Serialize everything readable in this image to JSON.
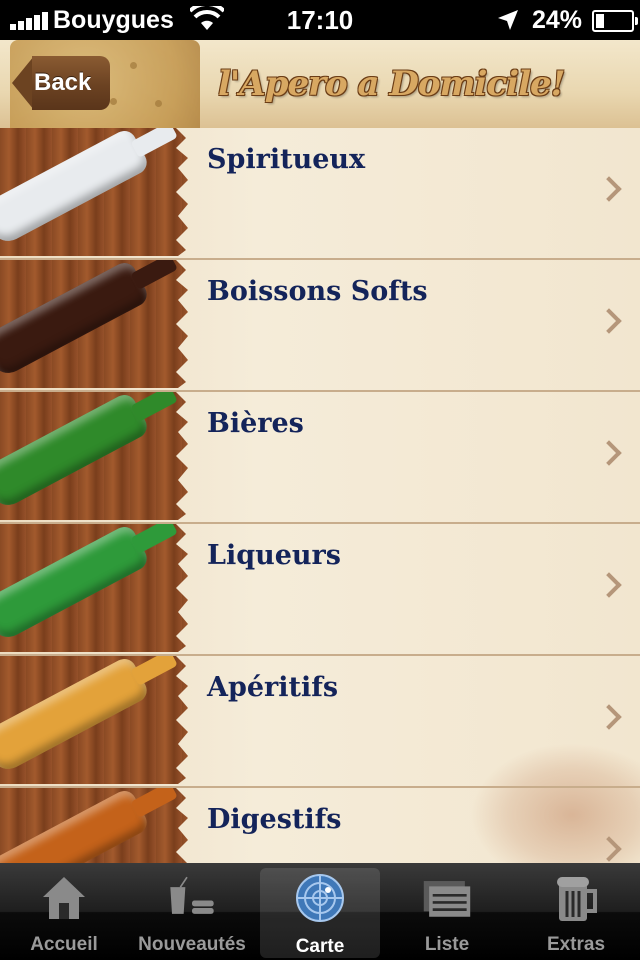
{
  "status_bar": {
    "carrier": "Bouygues",
    "time": "17:10",
    "battery_percent": "24%",
    "battery_level": 0.24
  },
  "header": {
    "back_label": "Back",
    "logo_text": "l'Apero a Domicile!"
  },
  "categories": [
    {
      "label": "Spiritueux",
      "icon": "vodka-bottle-icon",
      "bottle_color": "#e8ebee"
    },
    {
      "label": "Boissons Softs",
      "icon": "cola-bottle-icon",
      "bottle_color": "#3a1a10"
    },
    {
      "label": "Bières",
      "icon": "beer-bottles-icon",
      "bottle_color": "#2f8a2a"
    },
    {
      "label": "Liqueurs",
      "icon": "liqueur-bottle-icon",
      "bottle_color": "#2e9a3a"
    },
    {
      "label": "Apéritifs",
      "icon": "pastis-bottle-icon",
      "bottle_color": "#e3a23a"
    },
    {
      "label": "Digestifs",
      "icon": "cognac-bottle-icon",
      "bottle_color": "#c4621a"
    }
  ],
  "tab_bar": {
    "tabs": [
      {
        "label": "Accueil",
        "icon": "home-icon"
      },
      {
        "label": "Nouveautés",
        "icon": "new-drinks-icon"
      },
      {
        "label": "Carte",
        "icon": "radar-icon"
      },
      {
        "label": "Liste",
        "icon": "list-icon"
      },
      {
        "label": "Extras",
        "icon": "beer-mug-icon"
      }
    ],
    "selected": "Carte"
  },
  "colors": {
    "label_text": "#14245a",
    "header_brown": "#6b4222",
    "tab_active_label": "#ffffff",
    "tab_inactive_label": "#9a9a9a"
  }
}
